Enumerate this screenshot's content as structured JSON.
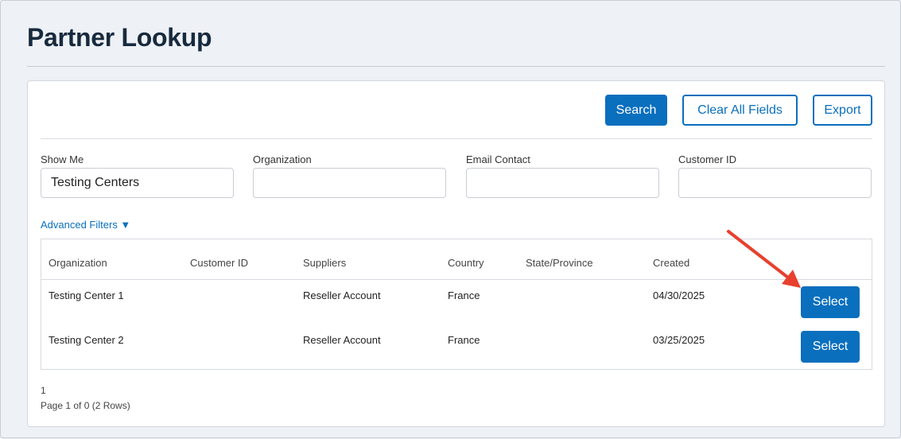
{
  "page": {
    "title": "Partner Lookup"
  },
  "toolbar": {
    "search_label": "Search",
    "clear_label": "Clear All Fields",
    "export_label": "Export"
  },
  "filters": {
    "show_me": {
      "label": "Show Me",
      "value": "Testing Centers"
    },
    "organization": {
      "label": "Organization",
      "value": ""
    },
    "email_contact": {
      "label": "Email Contact",
      "value": ""
    },
    "customer_id": {
      "label": "Customer ID",
      "value": ""
    },
    "advanced_label": "Advanced Filters ▼"
  },
  "table": {
    "columns": [
      "Organization",
      "Customer ID",
      "Suppliers",
      "Country",
      "State/Province",
      "Created"
    ],
    "rows": [
      {
        "organization": "Testing Center 1",
        "customer_id": "",
        "suppliers": "Reseller Account",
        "country": "France",
        "state": "",
        "created": "04/30/2025",
        "action": "Select"
      },
      {
        "organization": "Testing Center 2",
        "customer_id": "",
        "suppliers": "Reseller Account",
        "country": "France",
        "state": "",
        "created": "03/25/2025",
        "action": "Select"
      }
    ]
  },
  "pager": {
    "page_number": "1",
    "info": "Page 1 of 0 (2 Rows)"
  },
  "colors": {
    "accent": "#0a6fbd",
    "title": "#172a3e",
    "annotation_arrow": "#e8402e"
  }
}
